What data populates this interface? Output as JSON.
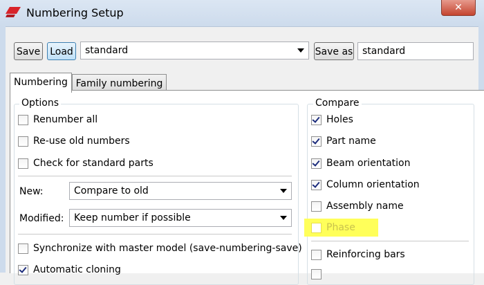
{
  "window": {
    "title": "Numbering Setup",
    "close_glyph": "✕"
  },
  "toolbar": {
    "save_label": "Save",
    "load_label": "Load",
    "preset_value": "standard",
    "save_as_label": "Save as",
    "save_as_value": "standard"
  },
  "tabs": [
    {
      "label": "Numbering",
      "selected": true
    },
    {
      "label": "Family numbering",
      "selected": false
    }
  ],
  "options": {
    "title": "Options",
    "checkboxes": [
      {
        "label": "Renumber all",
        "checked": false
      },
      {
        "label": "Re-use old numbers",
        "checked": false
      },
      {
        "label": "Check for standard parts",
        "checked": false
      }
    ],
    "new_label": "New:",
    "new_value": "Compare to old",
    "modified_label": "Modified:",
    "modified_value": "Keep number if possible",
    "bottom_checkboxes": [
      {
        "label": "Synchronize with master model (save-numbering-save)",
        "checked": false
      },
      {
        "label": "Automatic cloning",
        "checked": true
      }
    ]
  },
  "compare": {
    "title": "Compare",
    "checkboxes": [
      {
        "label": "Holes",
        "checked": true
      },
      {
        "label": "Part name",
        "checked": true
      },
      {
        "label": "Beam orientation",
        "checked": true
      },
      {
        "label": "Column orientation",
        "checked": true
      },
      {
        "label": "Assembly name",
        "checked": false
      },
      {
        "label": "Phase",
        "checked": false,
        "highlighted": true
      },
      {
        "label": "Reinforcing bars",
        "checked": false
      }
    ]
  },
  "colors": {
    "highlight": "#ffff5a",
    "titlebar": "#cddbec",
    "close": "#c4442f"
  }
}
